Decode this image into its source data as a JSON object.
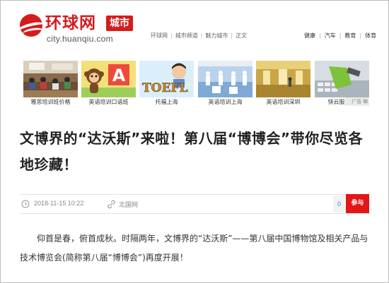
{
  "header": {
    "logo_name": "环球网",
    "logo_badge": "城市",
    "logo_domain": "city.huanqiu.com",
    "breadcrumb": [
      "环球网",
      "城市频道",
      "魅力城市",
      "正文"
    ],
    "channels": [
      "健康",
      "汽车",
      "教育",
      "体育"
    ]
  },
  "ads": {
    "items": [
      {
        "caption": "雅思培训班价格"
      },
      {
        "caption": "英语培训口语班"
      },
      {
        "caption": "托福上海"
      },
      {
        "caption": "英语培训上海"
      },
      {
        "caption": "英语培训深圳"
      },
      {
        "caption": "快云服务器"
      }
    ],
    "tag": "广告",
    "toefl_text": "TOEFL"
  },
  "article": {
    "title": "文博界的“达沃斯”来啦！第八届“博博会”带你尽览各地珍藏！",
    "date": "2018-11-15 10:22",
    "source": "北国网",
    "comment_count": "0",
    "join_label": "参与",
    "paragraph": "仰首是春，俯首成秋。时隔两年，文博界的“达沃斯”——第八届中国博物馆及相关产品与技术博览会(简称第八届“博博会”)再度开展！"
  },
  "colors": {
    "brand_red": "#d51c1c",
    "join_red": "#e41616",
    "count_blue": "#2c8fd6"
  }
}
